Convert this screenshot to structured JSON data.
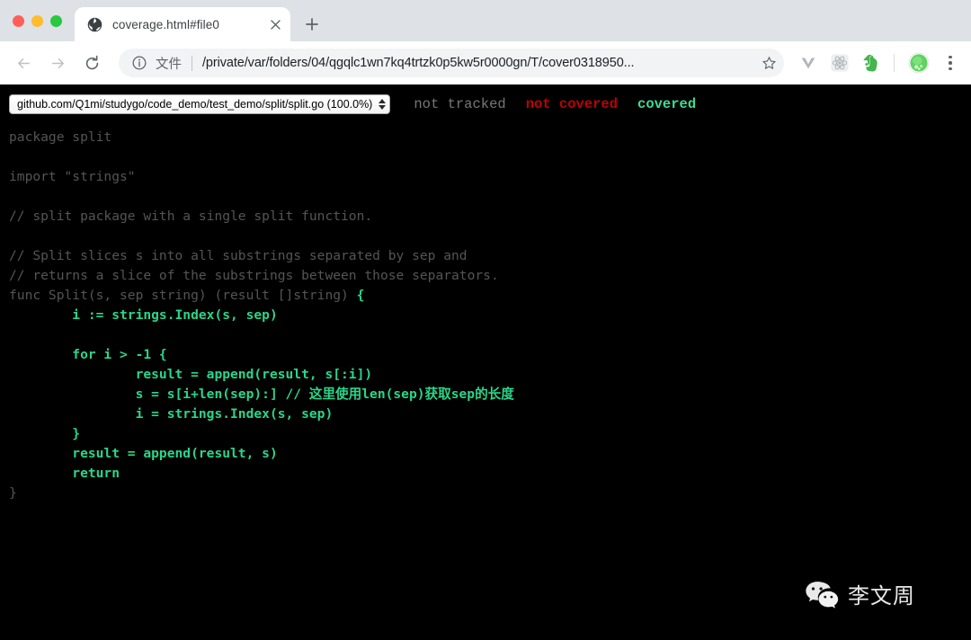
{
  "window": {
    "traffic_lights": [
      "close",
      "minimize",
      "maximize"
    ]
  },
  "browser": {
    "tab": {
      "title": "coverage.html#file0",
      "favicon": "globe-icon",
      "close_label": "×"
    },
    "new_tab_label": "+",
    "nav": {
      "back": "back-arrow-icon",
      "forward": "forward-arrow-icon",
      "reload": "reload-icon"
    },
    "omnibox": {
      "info_icon": "info-circle-icon",
      "scheme_label": "文件",
      "url": "/private/var/folders/04/qgqlc1wn7kq4trtzk0p5kw5r0000gn/T/cover0318950...",
      "star_icon": "star-outline-icon"
    },
    "extensions": [
      {
        "name": "vimeo-v-extension-icon"
      },
      {
        "name": "react-devtools-extension-icon"
      },
      {
        "name": "evernote-extension-icon"
      },
      {
        "name": "profile-avatar-icon"
      }
    ],
    "menu_icon": "three-dot-menu-icon"
  },
  "coverage": {
    "file_select": {
      "selected": "github.com/Q1mi/studygo/code_demo/test_demo/split/split.go (100.0%)",
      "stepper_icon": "up-down-stepper-icon"
    },
    "legend": {
      "not_tracked": "not tracked",
      "not_covered": "not covered",
      "covered": "covered"
    },
    "colors": {
      "not_tracked": "#555555",
      "not_covered": "#c00000",
      "covered": "#29d68a",
      "background": "#000000"
    },
    "code_lines": [
      {
        "segments": [
          {
            "text": "package split",
            "cov": "cov0"
          }
        ]
      },
      {
        "segments": [
          {
            "text": "",
            "cov": "cov0"
          }
        ]
      },
      {
        "segments": [
          {
            "text": "import \"strings\"",
            "cov": "cov0"
          }
        ]
      },
      {
        "segments": [
          {
            "text": "",
            "cov": "cov0"
          }
        ]
      },
      {
        "segments": [
          {
            "text": "// split package with a single split function.",
            "cov": "cov0"
          }
        ]
      },
      {
        "segments": [
          {
            "text": "",
            "cov": "cov0"
          }
        ]
      },
      {
        "segments": [
          {
            "text": "// Split slices s into all substrings separated by sep and",
            "cov": "cov0"
          }
        ]
      },
      {
        "segments": [
          {
            "text": "// returns a slice of the substrings between those separators.",
            "cov": "cov0"
          }
        ]
      },
      {
        "segments": [
          {
            "text": "func Split(s, sep string) (result []string) ",
            "cov": "cov0"
          },
          {
            "text": "{",
            "cov": "cov8"
          }
        ]
      },
      {
        "segments": [
          {
            "text": "        i := strings.Index(s, sep)",
            "cov": "cov8"
          }
        ]
      },
      {
        "segments": [
          {
            "text": "",
            "cov": "cov8"
          }
        ]
      },
      {
        "segments": [
          {
            "text": "        for i > -1 {",
            "cov": "cov8"
          }
        ]
      },
      {
        "segments": [
          {
            "text": "                result = append(result, s[:i])",
            "cov": "cov8"
          }
        ]
      },
      {
        "segments": [
          {
            "text": "                s = s[i+len(sep):] // 这里使用len(sep)获取sep的长度",
            "cov": "cov8"
          }
        ]
      },
      {
        "segments": [
          {
            "text": "                i = strings.Index(s, sep)",
            "cov": "cov8"
          }
        ]
      },
      {
        "segments": [
          {
            "text": "        }",
            "cov": "cov8"
          }
        ]
      },
      {
        "segments": [
          {
            "text": "        result = append(result, s)",
            "cov": "cov8"
          }
        ]
      },
      {
        "segments": [
          {
            "text": "        return",
            "cov": "cov8"
          }
        ]
      },
      {
        "segments": [
          {
            "text": "}",
            "cov": "cov0"
          }
        ]
      }
    ]
  },
  "watermark": {
    "icon": "wechat-icon",
    "text": "李文周"
  }
}
